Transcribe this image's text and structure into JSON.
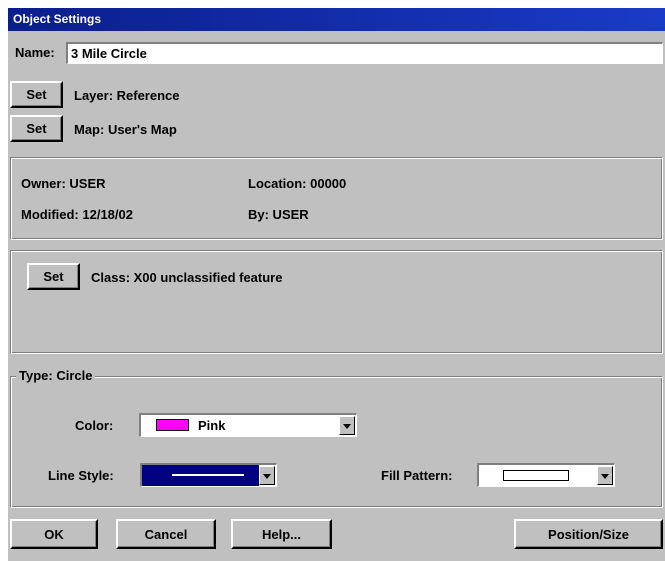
{
  "window": {
    "title": "Object Settings"
  },
  "name_row": {
    "label": "Name:",
    "value": "3 Mile Circle"
  },
  "layer_row": {
    "set_label": "Set",
    "text": "Layer: Reference"
  },
  "map_row": {
    "set_label": "Set",
    "text": "Map: User's Map"
  },
  "info": {
    "owner": "Owner: USER",
    "location": "Location: 00000",
    "modified": "Modified: 12/18/02",
    "by": "By: USER"
  },
  "class_row": {
    "set_label": "Set",
    "text": "Class:  X00 unclassified feature"
  },
  "type_group": {
    "legend": "Type: Circle",
    "color_label": "Color:",
    "color_value": "Pink",
    "color_swatch": "#ff00ff",
    "line_style_label": "Line Style:",
    "fill_pattern_label": "Fill Pattern:"
  },
  "buttons": {
    "ok": "OK",
    "cancel": "Cancel",
    "help": "Help...",
    "position_size": "Position/Size"
  },
  "colors": {
    "title_bar": "#0a1e8c",
    "dialog_bg": "#c0c0c0",
    "line_style_bg": "#000080"
  }
}
